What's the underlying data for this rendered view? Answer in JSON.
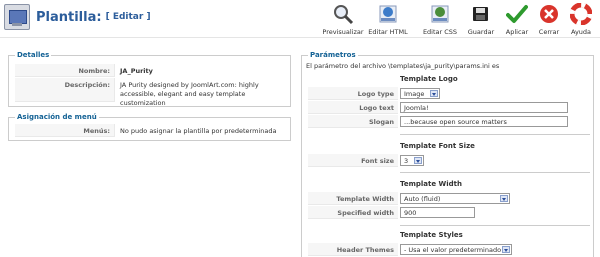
{
  "header": {
    "title": "Plantilla:",
    "edit_label": "[ Editar ]"
  },
  "toolbar": {
    "buttons": [
      {
        "label": "Previsualizar",
        "icon": "magnifier-icon"
      },
      {
        "label": "Editar HTML",
        "icon": "html-edit-icon"
      },
      {
        "label": "Editar CSS",
        "icon": "css-edit-icon"
      },
      {
        "label": "Guardar",
        "icon": "save-icon"
      },
      {
        "label": "Aplicar",
        "icon": "apply-check-icon"
      },
      {
        "label": "Cerrar",
        "icon": "close-icon"
      },
      {
        "label": "Ayuda",
        "icon": "help-lifebuoy-icon"
      }
    ]
  },
  "details": {
    "legend": "Detalles",
    "name_label": "Nombre:",
    "name_value": "JA_Purity",
    "desc_label": "Descripción:",
    "desc_value": "JA Purity designed by JoomlArt.com: highly accessible, elegant and easy template customization"
  },
  "menu_assign": {
    "legend": "Asignación de menú",
    "menus_label": "Menús:",
    "menus_value": "No pudo asignar la plantilla por predeterminada"
  },
  "params": {
    "legend": "Parámetros",
    "file_note": "El parámetro del archivo \\templates\\ja_purity\\params.ini es",
    "logo_head": "Template Logo",
    "logo_type_label": "Logo type",
    "logo_type_value": "Image",
    "logo_text_label": "Logo text",
    "logo_text_value": "Joomla!",
    "slogan_label": "Slogan",
    "slogan_value": "...because open source matters",
    "font_head": "Template Font Size",
    "font_size_label": "Font size",
    "font_size_value": "3",
    "width_head": "Template Width",
    "width_label": "Template Width",
    "width_value": "Auto (fluid)",
    "spec_width_label": "Specified width",
    "spec_width_value": "900",
    "styles_head": "Template Styles",
    "header_themes_label": "Header Themes",
    "header_themes_value": "- Usa el valor predeterminado -"
  }
}
